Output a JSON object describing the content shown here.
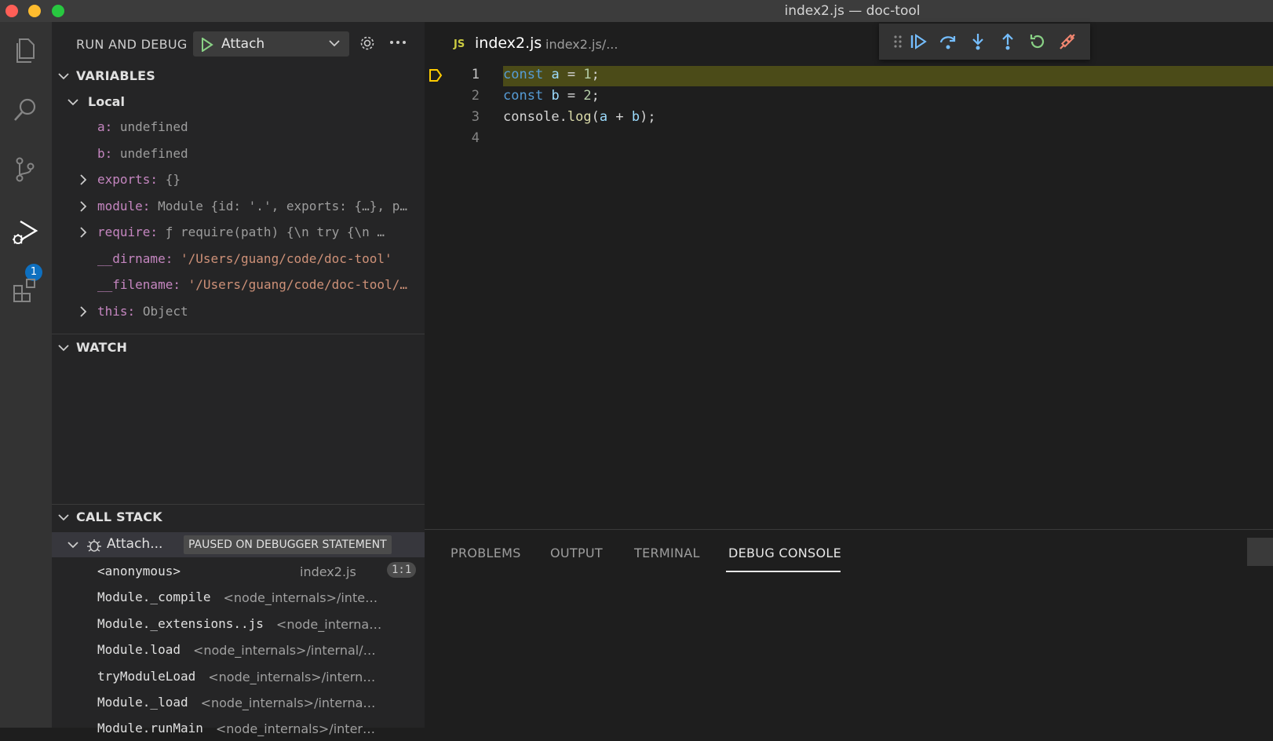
{
  "window": {
    "title": "index2.js — doc-tool"
  },
  "activity": {
    "debug_badge": "1"
  },
  "sidebar": {
    "title": "RUN AND DEBUG",
    "launch_config": "Attach",
    "variables": {
      "header": "VARIABLES",
      "scope": "Local",
      "items": [
        {
          "name": "a:",
          "value": "undefined",
          "kind": "plain",
          "expandable": false
        },
        {
          "name": "b:",
          "value": "undefined",
          "kind": "plain",
          "expandable": false
        },
        {
          "name": "exports:",
          "value": "{}",
          "kind": "plain",
          "expandable": true
        },
        {
          "name": "module:",
          "value": "Module {id: '.', exports: {…}, p…",
          "kind": "plain",
          "expandable": true
        },
        {
          "name": "require:",
          "value": "ƒ require(path) {\\n    try {\\n …",
          "kind": "plain",
          "expandable": true
        },
        {
          "name": "__dirname:",
          "value": "'/Users/guang/code/doc-tool'",
          "kind": "string",
          "expandable": false
        },
        {
          "name": "__filename:",
          "value": "'/Users/guang/code/doc-tool/…",
          "kind": "string",
          "expandable": false
        },
        {
          "name": "this:",
          "value": "Object",
          "kind": "plain",
          "expandable": true
        }
      ]
    },
    "watch": {
      "header": "WATCH"
    },
    "call_stack": {
      "header": "CALL STACK",
      "thread": "Attach...",
      "status": "PAUSED ON DEBUGGER STATEMENT",
      "frames": [
        {
          "fn": "<anonymous>",
          "src": "index2.js",
          "pos": "1:1"
        },
        {
          "fn": "Module._compile",
          "src": "<node_internals>/inte…"
        },
        {
          "fn": "Module._extensions..js",
          "src": "<node_interna…"
        },
        {
          "fn": "Module.load",
          "src": "<node_internals>/internal/…"
        },
        {
          "fn": "tryModuleLoad",
          "src": "<node_internals>/intern…"
        },
        {
          "fn": "Module._load",
          "src": "<node_internals>/interna…"
        },
        {
          "fn": "Module.runMain",
          "src": "<node_internals>/inter…"
        }
      ]
    }
  },
  "editor": {
    "tab": {
      "icon_text": "JS",
      "name": "index2.js",
      "path": "index2.js/..."
    },
    "line_numbers": [
      "1",
      "2",
      "3",
      "4"
    ],
    "code": {
      "l1": {
        "kw": "const",
        "id": "a",
        "op": " = ",
        "num": "1",
        "end": ";"
      },
      "l2": {
        "kw": "const",
        "id": "b",
        "op": " = ",
        "num": "2",
        "end": ";"
      },
      "l3": {
        "obj": "console",
        "dot": ".",
        "fn": "log",
        "open": "(",
        "a": "a",
        "plus": " + ",
        "b": "b",
        "close": ");"
      }
    }
  },
  "panel": {
    "tabs": [
      "PROBLEMS",
      "OUTPUT",
      "TERMINAL",
      "DEBUG CONSOLE"
    ],
    "active_tab": "DEBUG CONSOLE"
  },
  "colors": {
    "accent": "#0e70c0",
    "current_line": "#4b4b18",
    "breakpoint_arrow": "#ffcc00",
    "debug_blue": "#75beff",
    "debug_green": "#89d185",
    "debug_orange": "#f48771"
  }
}
